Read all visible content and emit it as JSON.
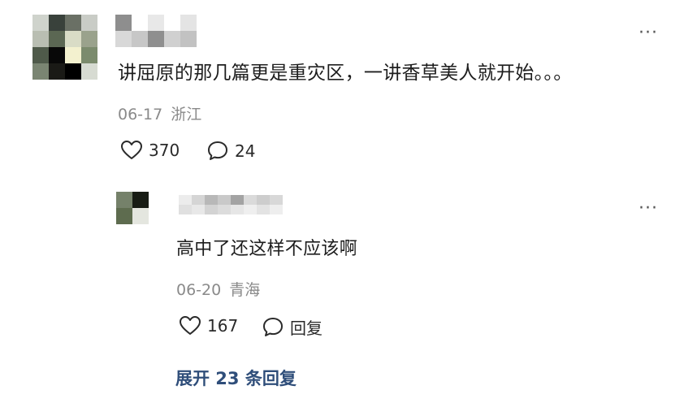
{
  "comment": {
    "avatar_mosaic": [
      "#cfd3cc",
      "#39413b",
      "#6a7065",
      "#c9ccc6",
      "#b9beb2",
      "#5b6753",
      "#d9dcc6",
      "#9aa28c",
      "#4f5a4a",
      "#080808",
      "#f3f1cf",
      "#7b8b6d",
      "#7a8572",
      "#1a1a16",
      "#000000",
      "#d7dbd2"
    ],
    "name_mosaic": [
      "#8e8e8e",
      "#d8d8d8",
      "#ffffff",
      "#c7c7c7",
      "#e8e8e8",
      "#8f8f8f",
      "#ffffff",
      "#d0d0d0",
      "#e4e4e4",
      "#c2c2c2"
    ],
    "text": "讲屈原的那几篇更是重灾区，一讲香草美人就开始。。。",
    "date": "06-17",
    "location": "浙江",
    "likes": "370",
    "replies": "24",
    "more": "···"
  },
  "reply": {
    "avatar_mosaic": [
      "#75816a",
      "#181c14",
      "#5e6c4f",
      "#e4e6df"
    ],
    "name_mosaic": [
      "#ececec",
      "#e0e0e0",
      "#d5d5d5",
      "#e8e8e8",
      "#b8b8b8",
      "#d3d3d3",
      "#c9c9c9",
      "#dcdcdc",
      "#a3a3a3",
      "#e6e6e6",
      "#dadada",
      "#efefef",
      "#cdcdcd",
      "#e3e3e3",
      "#d8d8d8",
      "#eeeeee"
    ],
    "text": "高中了还这样不应该啊",
    "date": "06-20",
    "location": "青海",
    "likes": "167",
    "reply_label": "回复",
    "more": "···"
  },
  "expand_label": "展开 23 条回复",
  "colors": {
    "link": "#2f4e7a",
    "meta": "#8a8a8a",
    "text": "#1d1d1d"
  },
  "icons": {
    "like": "heart-outline-icon",
    "comment": "speech-bubble-icon"
  }
}
